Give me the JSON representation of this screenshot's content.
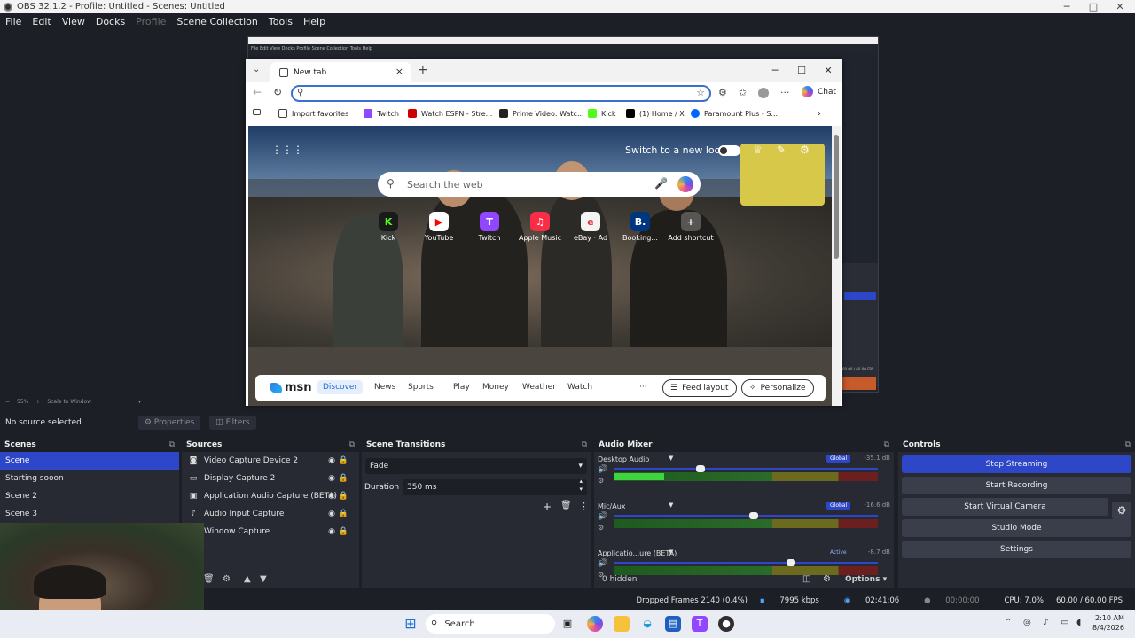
{
  "window": {
    "title": "OBS 32.1.2 - Profile: Untitled - Scenes: Untitled",
    "minimize": "─",
    "maximize": "□",
    "close": "✕"
  },
  "menu": [
    "File",
    "Edit",
    "View",
    "Docks",
    "Profile",
    "Scene Collection",
    "Tools",
    "Help"
  ],
  "browser": {
    "tab_title": "New tab",
    "chat_label": "Chat",
    "favorites": [
      {
        "label": "Import favorites",
        "color": "#444444"
      },
      {
        "label": "Twitch",
        "color": "#9146ff"
      },
      {
        "label": "Watch ESPN - Stre...",
        "color": "#cc0000"
      },
      {
        "label": "Prime Video: Watc...",
        "color": "#222222"
      },
      {
        "label": "Kick",
        "color": "#53fc18"
      },
      {
        "label": "(1) Home / X",
        "color": "#000000"
      },
      {
        "label": "Paramount Plus - S...",
        "color": "#0064ff"
      }
    ],
    "newtab": {
      "switch_look": "Switch to a new look",
      "search_placeholder": "Search the web",
      "shortcuts": [
        {
          "label": "Kick",
          "glyph": "K",
          "color": "#53fc18"
        },
        {
          "label": "YouTube",
          "glyph": "▶",
          "color": "#ff0000"
        },
        {
          "label": "Twitch",
          "glyph": "T",
          "color": "#9146ff"
        },
        {
          "label": "Apple Music",
          "glyph": "♫",
          "color": "#fa2d48"
        },
        {
          "label": "eBay · Ad",
          "glyph": "e",
          "color": "#f4f4f4"
        },
        {
          "label": "Booking...",
          "glyph": "B.",
          "color": "#003580"
        },
        {
          "label": "Add shortcut",
          "glyph": "+",
          "color": "#666666"
        }
      ],
      "msn": {
        "logo": "msn",
        "tabs": [
          "Discover",
          "News",
          "Sports",
          "Play",
          "Money",
          "Weather",
          "Watch"
        ],
        "more": "···",
        "feed_layout": "Feed layout",
        "personalize": "Personalize"
      }
    }
  },
  "preview_toolbar": {
    "zoom": "55%",
    "scale": "Scale to Window"
  },
  "source_toolbar": {
    "no_source": "No source selected",
    "properties": "Properties",
    "filters": "Filters"
  },
  "scenes": {
    "title": "Scenes",
    "items": [
      "Scene",
      "Starting sooon",
      "Scene 2",
      "Scene 3"
    ],
    "selected": 0
  },
  "sources": {
    "title": "Sources",
    "items": [
      {
        "label": "Video Capture Device 2",
        "icon": "camera-icon"
      },
      {
        "label": "Display Capture 2",
        "icon": "monitor-icon"
      },
      {
        "label": "Application Audio Capture (BETA)",
        "icon": "app-audio-icon"
      },
      {
        "label": "Audio Input Capture",
        "icon": "mic-icon"
      },
      {
        "label": "Window Capture",
        "icon": "window-icon"
      }
    ]
  },
  "transitions": {
    "title": "Scene Transitions",
    "selected": "Fade",
    "duration_label": "Duration",
    "duration_value": "350 ms"
  },
  "mixer": {
    "title": "Audio Mixer",
    "channels": [
      {
        "name": "Desktop Audio",
        "badge": "Global",
        "db": "-35.1 dB",
        "level": 0.19,
        "fader": 0.33
      },
      {
        "name": "Mic/Aux",
        "badge": "Global",
        "db": "-16.6 dB",
        "level": 0,
        "fader": 0.53
      },
      {
        "name": "Applicatio...ure (BETA)",
        "badge": "Active",
        "db": "-8.7 dB",
        "level": 0,
        "fader": 0.67
      }
    ],
    "hidden": "0 hidden",
    "options": "Options"
  },
  "controls": {
    "title": "Controls",
    "buttons": [
      "Stop Streaming",
      "Start Recording",
      "Start Virtual Camera",
      "Studio Mode",
      "Settings"
    ]
  },
  "status": {
    "dropped": "Dropped Frames 2140 (0.4%)",
    "bitrate": "7995 kbps",
    "stream_time": "02:41:06",
    "rec_time": "00:00:00",
    "cpu": "CPU: 7.0%",
    "fps": "60.00 / 60.00 FPS"
  },
  "taskbar": {
    "search": "Search",
    "time": "2:10 AM",
    "date": "8/4/2026"
  }
}
